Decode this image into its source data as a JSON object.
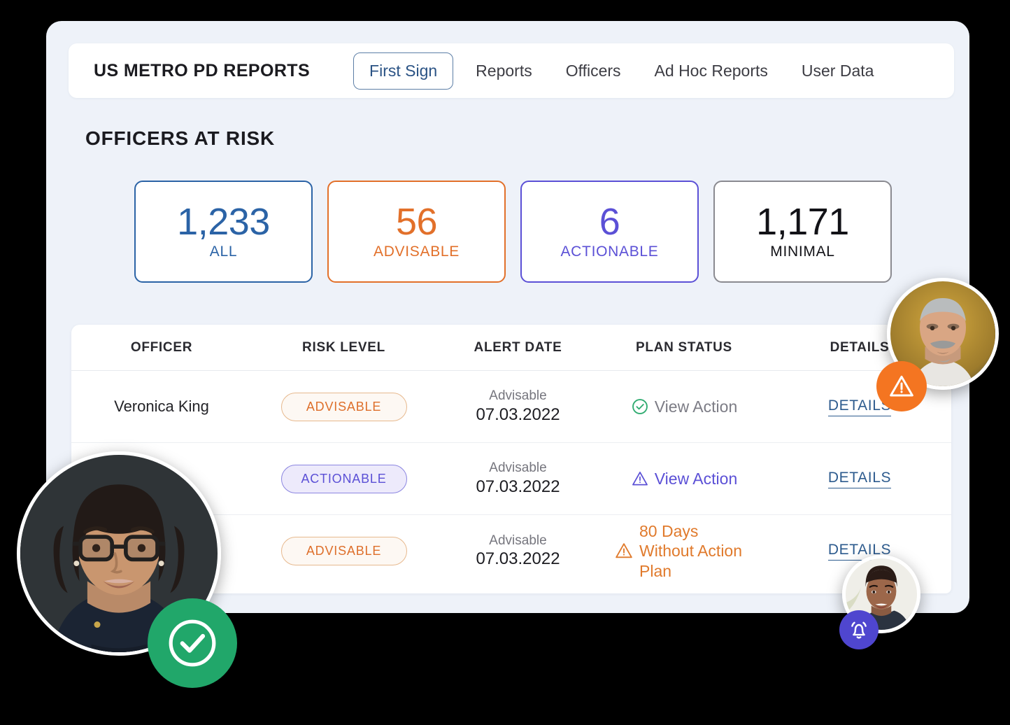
{
  "header": {
    "brand_title": "US METRO PD REPORTS",
    "tabs": [
      {
        "label": "First Sign",
        "active": true
      },
      {
        "label": "Reports",
        "active": false
      },
      {
        "label": "Officers",
        "active": false
      },
      {
        "label": "Ad Hoc Reports",
        "active": false
      },
      {
        "label": "User Data",
        "active": false
      }
    ]
  },
  "page": {
    "section_title": "OFFICERS AT RISK"
  },
  "stats": [
    {
      "value": "1,233",
      "label": "ALL",
      "color": "#2b63a6",
      "border": "#2b63a6"
    },
    {
      "value": "56",
      "label": "ADVISABLE",
      "color": "#e2702a",
      "border": "#e2702a"
    },
    {
      "value": "6",
      "label": "ACTIONABLE",
      "color": "#5b50d6",
      "border": "#5b50d6"
    },
    {
      "value": "1,171",
      "label": "MINIMAL",
      "color": "#121217",
      "border": "#8a8a90"
    }
  ],
  "table": {
    "columns": [
      "OFFICER",
      "RISK LEVEL",
      "ALERT DATE",
      "PLAN STATUS",
      "DETAILS"
    ],
    "rows": [
      {
        "officer": "Veronica King",
        "risk_level": "ADVISABLE",
        "risk_style": "advisable",
        "alert_kicker": "Advisable",
        "alert_date": "07.03.2022",
        "plan_status": "View Action",
        "plan_icon": "check-circle-icon",
        "plan_style": "ok",
        "details_label": "DETAILS"
      },
      {
        "officer": "",
        "risk_level": "ACTIONABLE",
        "risk_style": "actionable",
        "alert_kicker": "Advisable",
        "alert_date": "07.03.2022",
        "plan_status": "View Action",
        "plan_icon": "warning-triangle-icon",
        "plan_style": "warn-purple",
        "details_label": "DETAILS"
      },
      {
        "officer": "",
        "risk_level": "ADVISABLE",
        "risk_style": "advisable",
        "alert_kicker": "Advisable",
        "alert_date": "07.03.2022",
        "plan_status": "80 Days Without Action Plan",
        "plan_icon": "warning-triangle-icon",
        "plan_style": "warn-orange",
        "details_label": "DETAILS"
      }
    ]
  },
  "avatars": [
    {
      "name": "officer-avatar-top-right",
      "badge": "warning-badge",
      "badge_color": "#f47521"
    },
    {
      "name": "officer-avatar-bottom-left",
      "badge": "check-badge",
      "badge_color": "#21a76a"
    },
    {
      "name": "officer-avatar-bottom-right",
      "badge": "bell-badge",
      "badge_color": "#4f46cf"
    }
  ],
  "theme": {
    "panel_bg": "#eef2f9",
    "card_bg": "#ffffff",
    "accent_blue": "#2b63a6",
    "accent_orange": "#e2702a",
    "accent_purple": "#5b50d6",
    "link_navy": "#2d5b8e",
    "success_green": "#21a76a"
  }
}
